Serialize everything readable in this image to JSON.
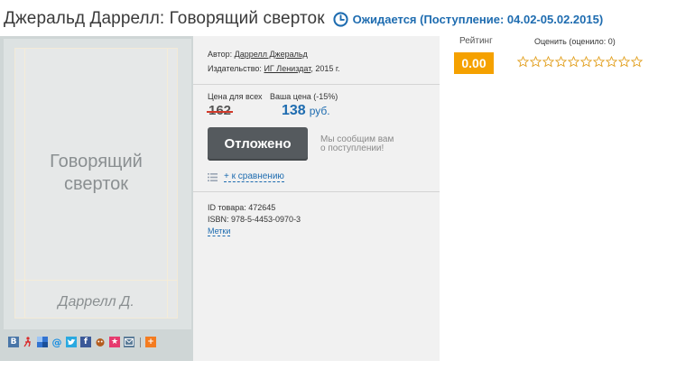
{
  "header": {
    "title": "Джеральд Даррелл: Говорящий сверток",
    "availability": "Ожидается (Поступление: 04.02-05.02.2015)"
  },
  "cover": {
    "title_line1": "Говорящий",
    "title_line2": "сверток",
    "author": "Даррелл Д."
  },
  "meta": {
    "author_label": "Автор:",
    "author_name": "Даррелл Джеральд",
    "publisher_label": "Издательство:",
    "publisher_name": "ИГ Лениздат",
    "year": ", 2015 г."
  },
  "price": {
    "all_label": "Цена для всех",
    "your_label": "Ваша цена (-15%)",
    "old_value": "162",
    "new_value": "138",
    "currency": "руб."
  },
  "actions": {
    "postponed_label": "Отложено",
    "notify_line1": "Мы сообщим вам",
    "notify_line2": "о поступлении!",
    "compare_label": "+ к сравнению"
  },
  "ids": {
    "id_line": "ID товара: 472645",
    "isbn_line": "ISBN: 978-5-4453-0970-3",
    "tags_label": "Метки"
  },
  "rating": {
    "label": "Рейтинг",
    "value": "0.00",
    "rate_label": "Оценить (оценило: 0)",
    "stars_total": 10,
    "stars_filled": 0
  },
  "share": {
    "icons": [
      "vk-icon",
      "lj-icon",
      "delicious-icon",
      "mail-icon",
      "twitter-icon",
      "facebook-icon",
      "moimir-icon",
      "bookmarks-icon",
      "email-icon",
      "more-icon"
    ],
    "colors": {
      "vk": "#4a76a8",
      "lj": "#d92a2a",
      "delicious": "#3274d1",
      "mail": "#168de2",
      "twitter": "#2aa9e0",
      "facebook": "#3b5998",
      "moimir": "#b35c1e",
      "bookmarks": "#e63a6e",
      "email": "#5c7d99",
      "more": "#f47c20"
    }
  },
  "colors": {
    "accent": "#1e6cb0",
    "rating_badge": "#f5a100",
    "button": "#555a5e",
    "strike": "#d23a2a"
  }
}
